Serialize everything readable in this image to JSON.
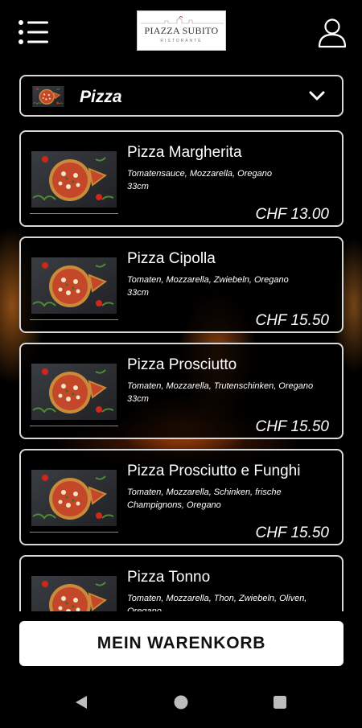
{
  "header": {
    "menu_icon": "hamburger-menu-icon",
    "logo_text": "PIAZZA SUBITO",
    "logo_sub": "RISTORANTE",
    "user_icon": "user-icon"
  },
  "category": {
    "label": "Pizza",
    "icon": "chevron-down-icon"
  },
  "items": [
    {
      "name": "Pizza Margherita",
      "desc": "Tomatensauce, Mozzarella, Oregano",
      "size": "33cm",
      "price": "CHF 13.00"
    },
    {
      "name": "Pizza Cipolla",
      "desc": "Tomaten, Mozzarella, Zwiebeln, Oregano",
      "size": "33cm",
      "price": "CHF 15.50"
    },
    {
      "name": "Pizza Prosciutto",
      "desc": "Tomaten, Mozzarella, Trutenschinken, Oregano",
      "size": "33cm",
      "price": "CHF 15.50"
    },
    {
      "name": "Pizza Prosciutto e Funghi",
      "desc": "Tomaten, Mozzarella, Schinken, frische Champignons, Oregano",
      "size": "",
      "price": "CHF 15.50"
    },
    {
      "name": "Pizza Tonno",
      "desc": "Tomaten, Mozzarella, Thon, Zwiebeln, Oliven, Oregano",
      "size": "",
      "price": ""
    }
  ],
  "cart": {
    "label": "MEIN WARENKORB"
  },
  "navbar": {
    "back_icon": "back-triangle-icon",
    "home_icon": "home-circle-icon",
    "recents_icon": "recents-square-icon"
  }
}
